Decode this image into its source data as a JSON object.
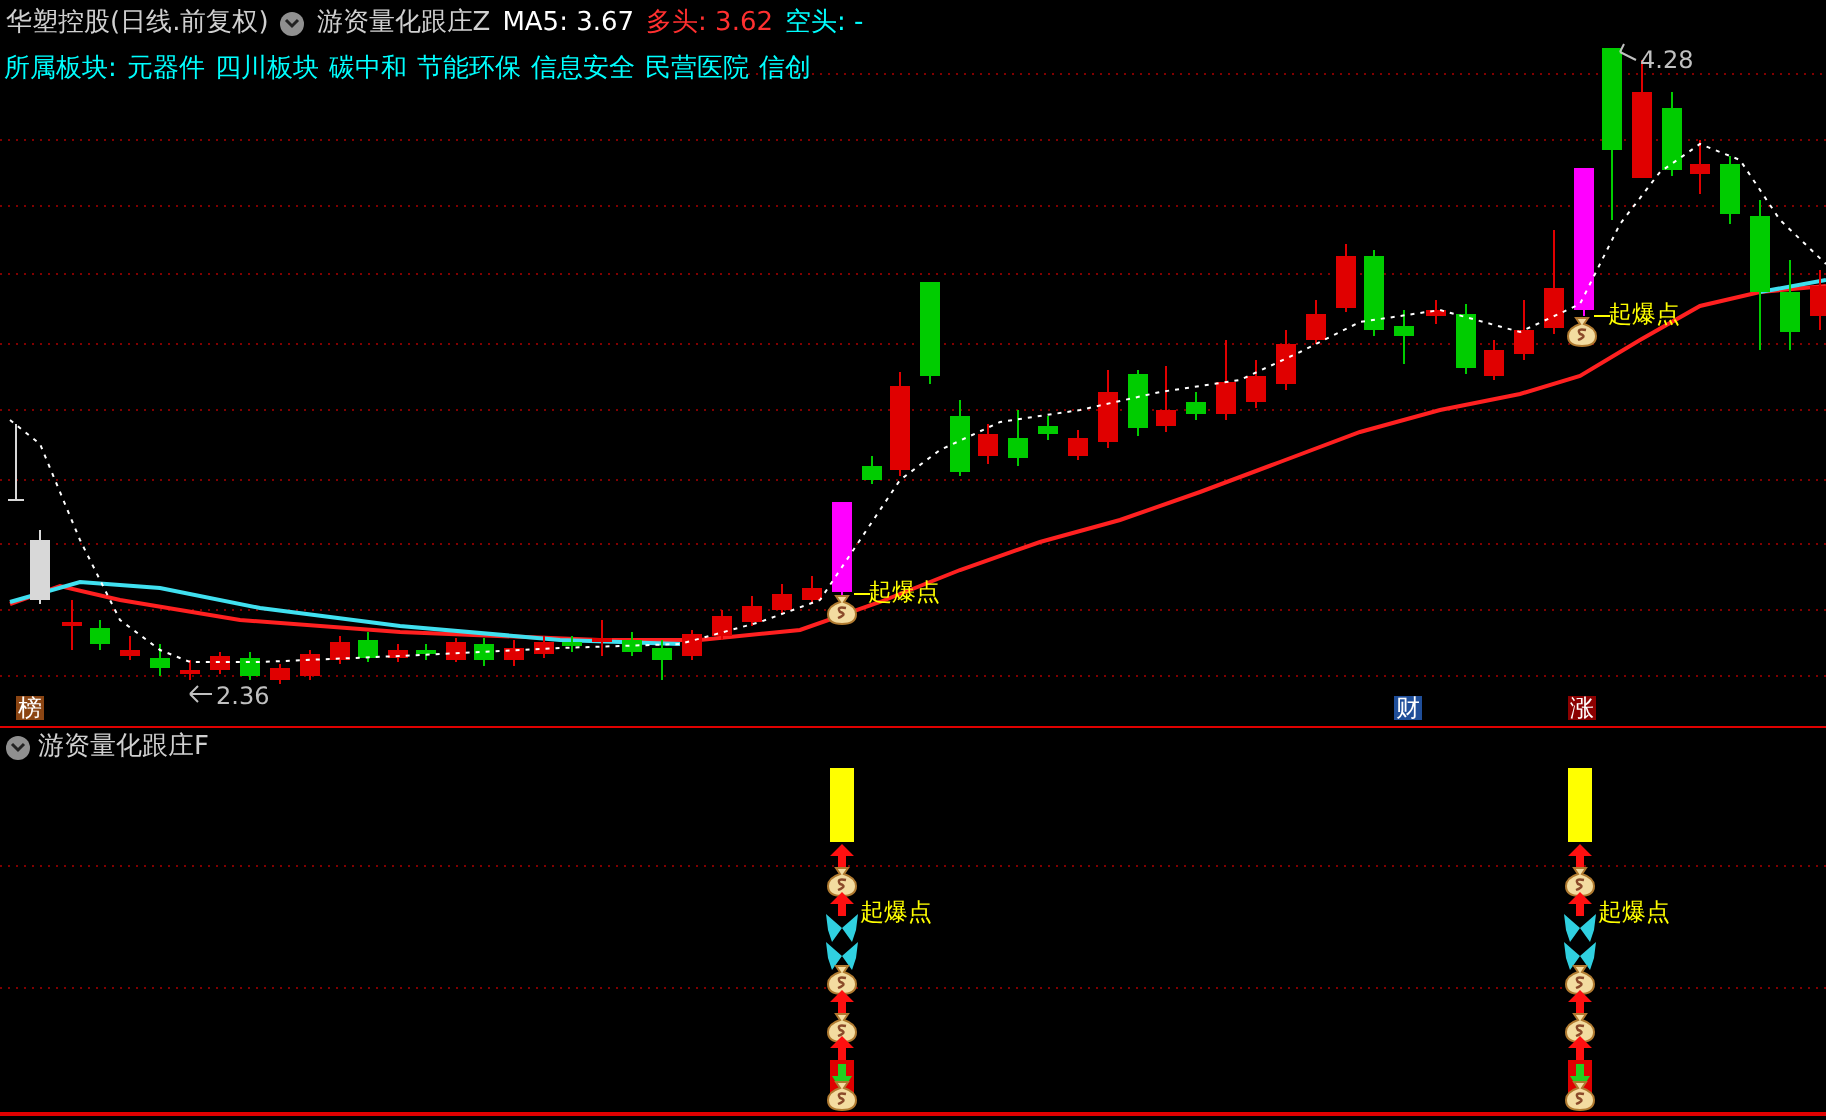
{
  "header": {
    "stock": "华塑控股(日线.前复权)",
    "indicator": "游资量化跟庄Z",
    "ma5": "MA5: 3.67",
    "bull": "多头: 3.62",
    "bear": "空头: -"
  },
  "sectors": {
    "label": "所属板块:",
    "items": [
      "元器件",
      "四川板块",
      "碳中和",
      "节能环保",
      "信息安全",
      "民营医院",
      "信创"
    ]
  },
  "main_chart": {
    "high_label": "4.28",
    "low_label": "2.36",
    "signals": [
      "起爆点",
      "起爆点"
    ]
  },
  "markers": [
    {
      "text": "榜",
      "color": "#8b4513"
    },
    {
      "text": "财",
      "color": "#1f4e99"
    },
    {
      "text": "涨",
      "color": "#8b0000"
    }
  ],
  "lower_pane": {
    "title": "游资量化跟庄F",
    "signals": [
      "起爆点",
      "起爆点"
    ]
  }
}
